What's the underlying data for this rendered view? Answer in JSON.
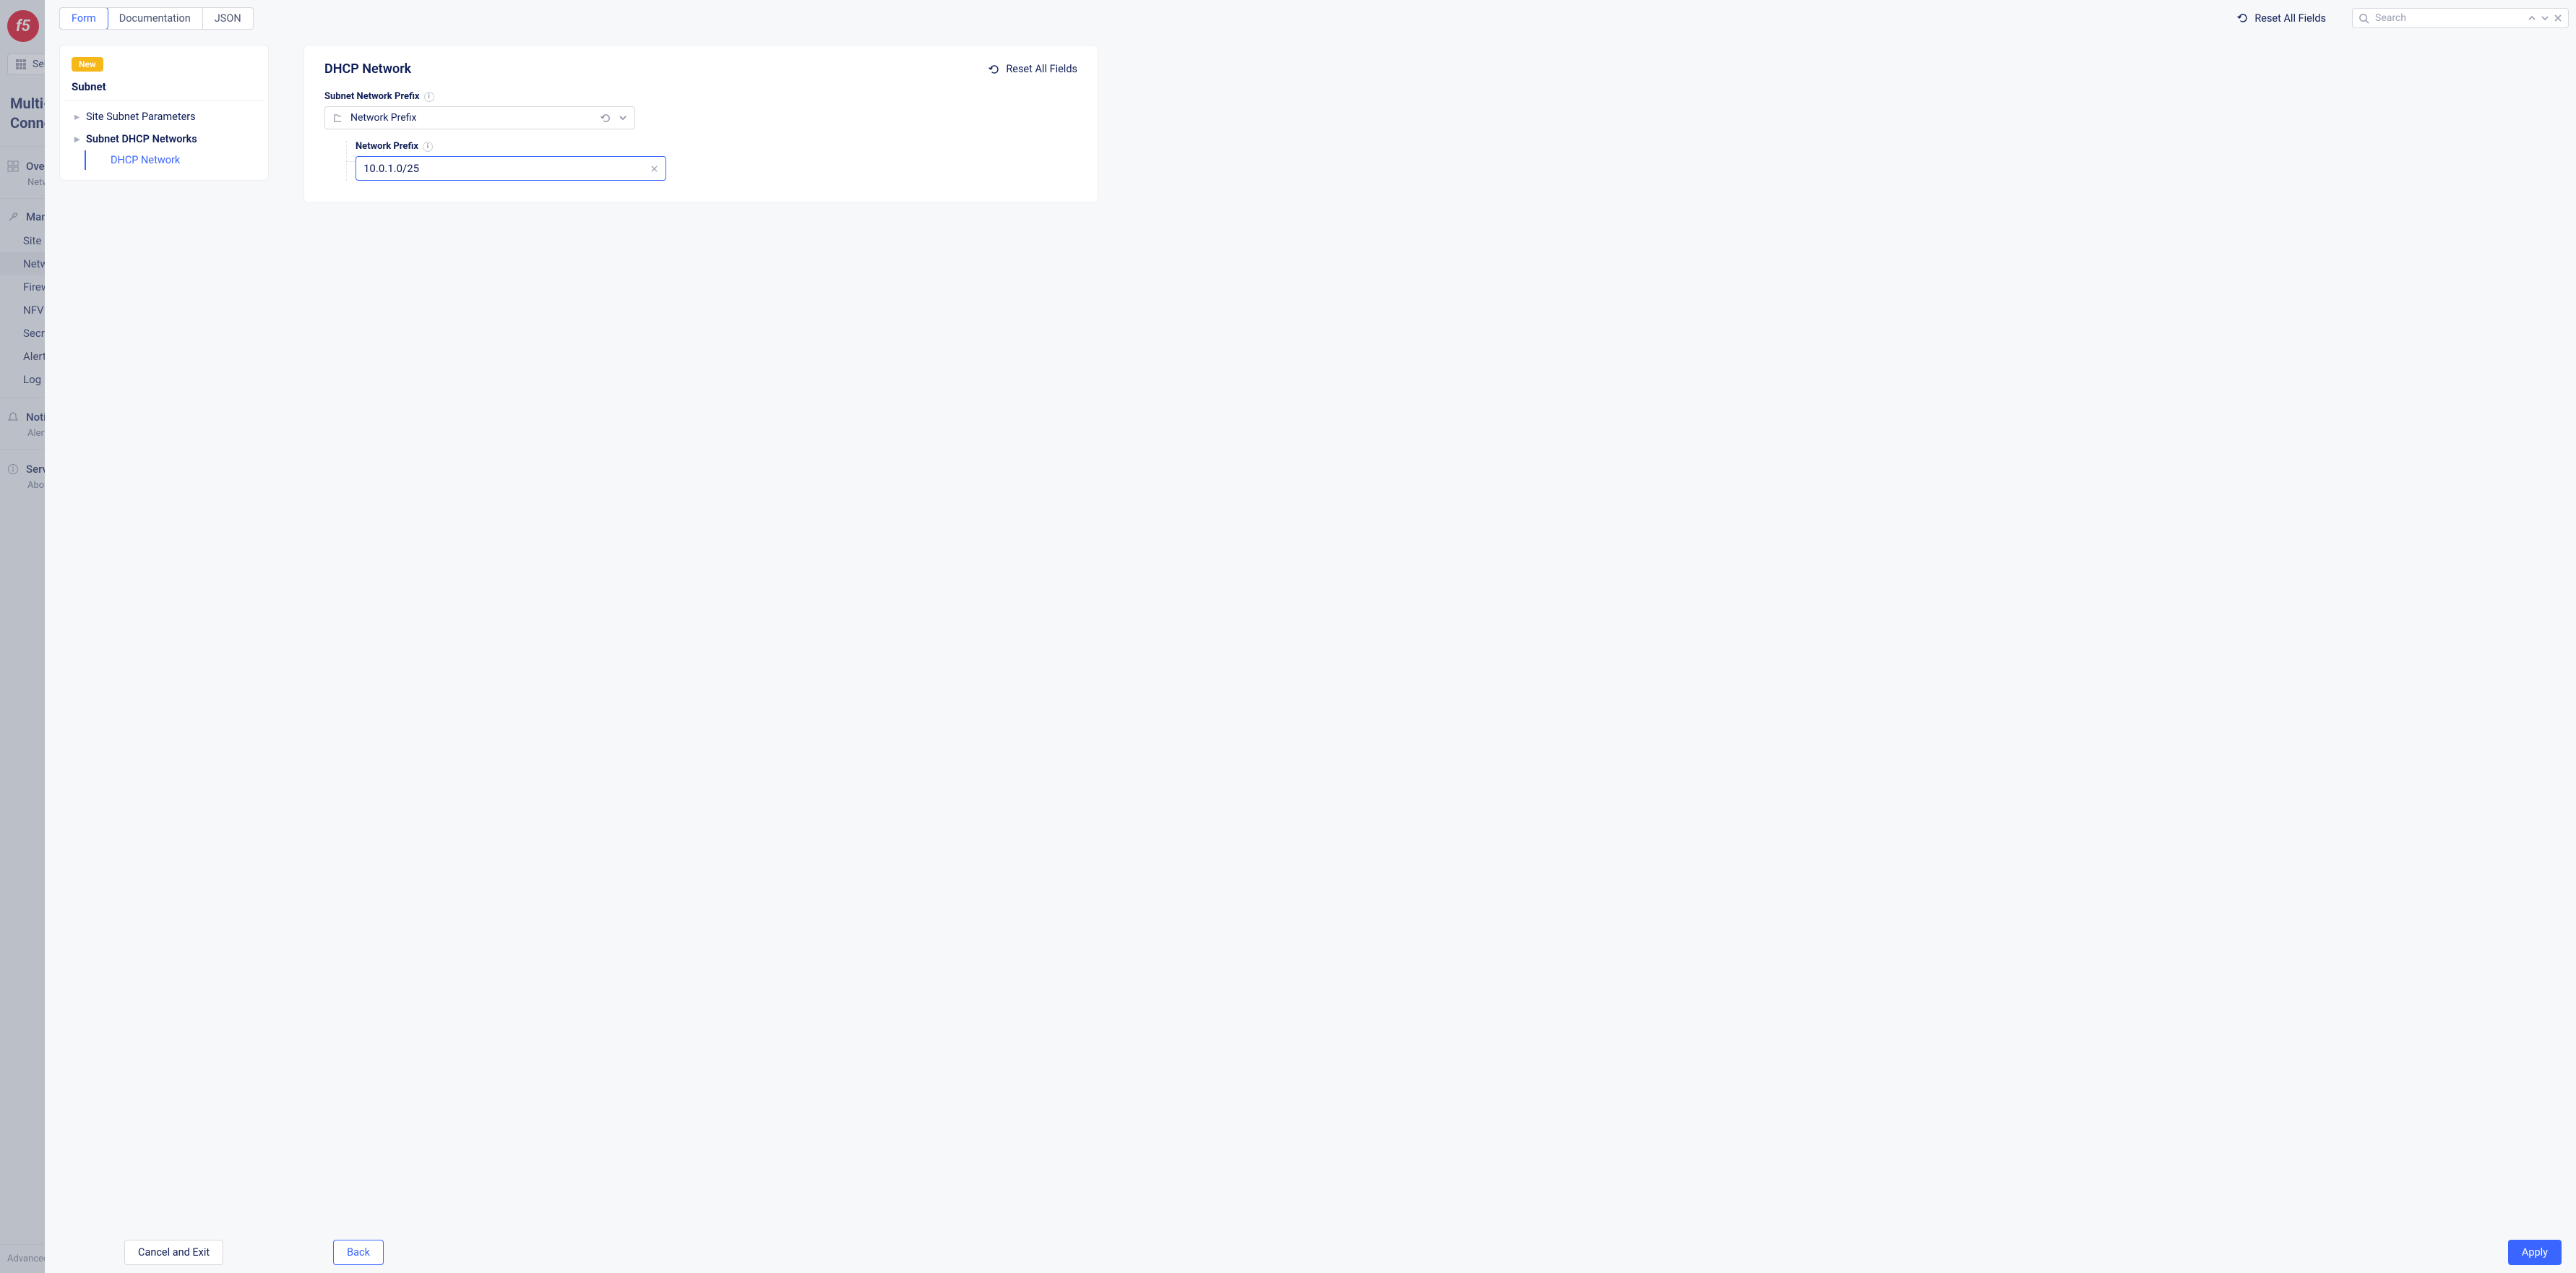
{
  "bg": {
    "selector_label": "Select service",
    "app_title": "Multi-Cloud Network Connect",
    "overview": {
      "title": "Overview",
      "subtitle": "Network Topology"
    },
    "manage_label": "Manage",
    "nav": [
      "Site Management",
      "Networking",
      "Firewall",
      "NFV Services",
      "Secrets",
      "Alerts Management",
      "Log Management"
    ],
    "notifications": {
      "title": "Notifications",
      "subtitle": "Alerts"
    },
    "services_title": "Services",
    "services_subtitle": "About",
    "footer": "Advanced nav options"
  },
  "header": {
    "tabs": [
      "Form",
      "Documentation",
      "JSON"
    ],
    "active_tab": 0,
    "reset_label": "Reset All Fields",
    "search_placeholder": "Search"
  },
  "nav_card": {
    "badge": "New",
    "heading": "Subnet",
    "items": {
      "site_subnet": "Site Subnet Parameters",
      "dhcp_networks": "Subnet DHCP Networks",
      "dhcp_network": "DHCP Network"
    }
  },
  "content": {
    "title": "DHCP Network",
    "reset_label": "Reset All Fields",
    "subnet_prefix_label": "Subnet Network Prefix",
    "selector_value": "Network Prefix",
    "network_prefix_label": "Network Prefix",
    "network_prefix_value": "10.0.1.0/25"
  },
  "footer": {
    "cancel": "Cancel and Exit",
    "back": "Back",
    "apply": "Apply"
  }
}
